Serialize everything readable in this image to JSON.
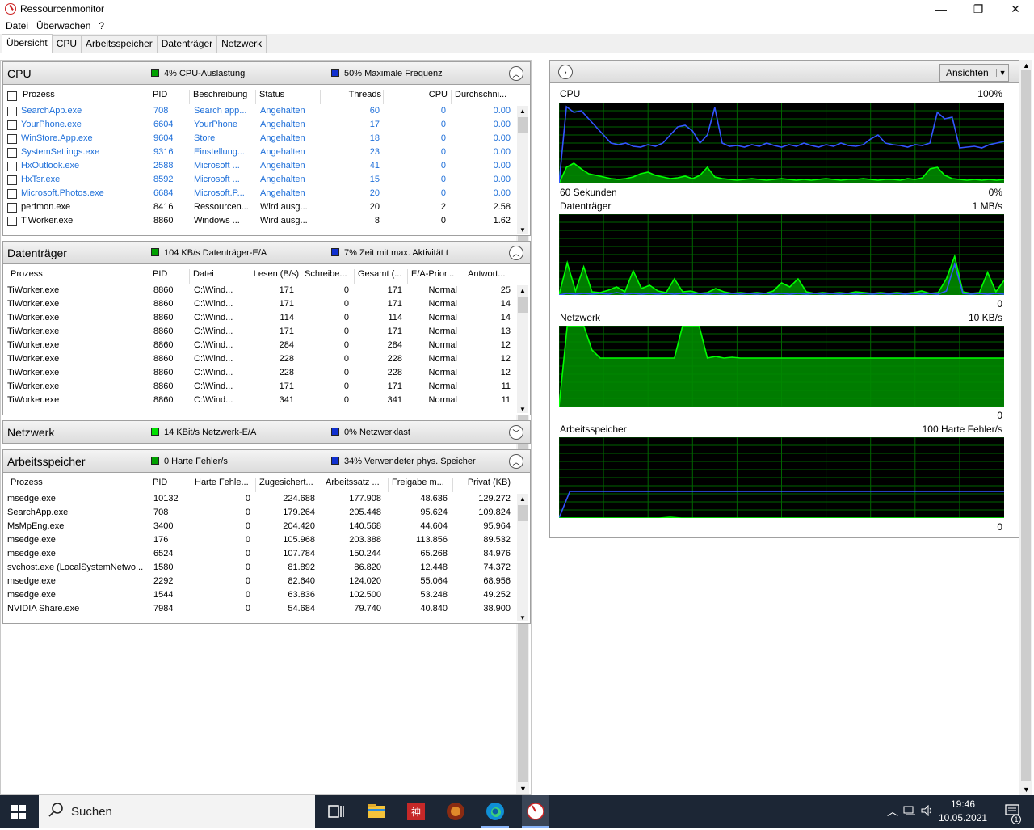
{
  "window": {
    "title": "Ressourcenmonitor",
    "minimize": "—",
    "maximize": "❐",
    "close": "✕"
  },
  "menu": [
    "Datei",
    "Überwachen",
    "?"
  ],
  "tabs": [
    "Übersicht",
    "CPU",
    "Arbeitsspeicher",
    "Datenträger",
    "Netzwerk"
  ],
  "cpu": {
    "name": "CPU",
    "stat1": "4% CPU-Auslastung",
    "stat2": "50% Maximale Frequenz",
    "columns": [
      "Prozess",
      "PID",
      "Beschreibung",
      "Status",
      "Threads",
      "CPU",
      "Durchschni..."
    ],
    "rows": [
      [
        "SearchApp.exe",
        "708",
        "Search app...",
        "Angehalten",
        "60",
        "0",
        "0.00",
        true
      ],
      [
        "YourPhone.exe",
        "6604",
        "YourPhone",
        "Angehalten",
        "17",
        "0",
        "0.00",
        true
      ],
      [
        "WinStore.App.exe",
        "9604",
        "Store",
        "Angehalten",
        "18",
        "0",
        "0.00",
        true
      ],
      [
        "SystemSettings.exe",
        "9316",
        "Einstellung...",
        "Angehalten",
        "23",
        "0",
        "0.00",
        true
      ],
      [
        "HxOutlook.exe",
        "2588",
        "Microsoft ...",
        "Angehalten",
        "41",
        "0",
        "0.00",
        true
      ],
      [
        "HxTsr.exe",
        "8592",
        "Microsoft ...",
        "Angehalten",
        "15",
        "0",
        "0.00",
        true
      ],
      [
        "Microsoft.Photos.exe",
        "6684",
        "Microsoft.P...",
        "Angehalten",
        "20",
        "0",
        "0.00",
        true
      ],
      [
        "perfmon.exe",
        "8416",
        "Ressourcen...",
        "Wird ausg...",
        "20",
        "2",
        "2.58",
        false
      ],
      [
        "TiWorker.exe",
        "8860",
        "Windows ...",
        "Wird ausg...",
        "8",
        "0",
        "1.62",
        false
      ]
    ]
  },
  "disk": {
    "name": "Datenträger",
    "stat1": "104 KB/s Datenträger-E/A",
    "stat2": "7% Zeit mit max. Aktivität t",
    "columns": [
      "Prozess",
      "PID",
      "Datei",
      "Lesen (B/s)",
      "Schreibe...",
      "Gesamt (...",
      "E/A-Prior...",
      "Antwort..."
    ],
    "rows": [
      [
        "TiWorker.exe",
        "8860",
        "C:\\Wind...",
        "171",
        "0",
        "171",
        "Normal",
        "25"
      ],
      [
        "TiWorker.exe",
        "8860",
        "C:\\Wind...",
        "171",
        "0",
        "171",
        "Normal",
        "14"
      ],
      [
        "TiWorker.exe",
        "8860",
        "C:\\Wind...",
        "114",
        "0",
        "114",
        "Normal",
        "14"
      ],
      [
        "TiWorker.exe",
        "8860",
        "C:\\Wind...",
        "171",
        "0",
        "171",
        "Normal",
        "13"
      ],
      [
        "TiWorker.exe",
        "8860",
        "C:\\Wind...",
        "284",
        "0",
        "284",
        "Normal",
        "12"
      ],
      [
        "TiWorker.exe",
        "8860",
        "C:\\Wind...",
        "228",
        "0",
        "228",
        "Normal",
        "12"
      ],
      [
        "TiWorker.exe",
        "8860",
        "C:\\Wind...",
        "228",
        "0",
        "228",
        "Normal",
        "12"
      ],
      [
        "TiWorker.exe",
        "8860",
        "C:\\Wind...",
        "171",
        "0",
        "171",
        "Normal",
        "11"
      ],
      [
        "TiWorker.exe",
        "8860",
        "C:\\Wind...",
        "341",
        "0",
        "341",
        "Normal",
        "11"
      ]
    ]
  },
  "network": {
    "name": "Netzwerk",
    "stat1": "14 KBit/s Netzwerk-E/A",
    "stat2": "0% Netzwerklast"
  },
  "memory": {
    "name": "Arbeitsspeicher",
    "stat1": "0 Harte Fehler/s",
    "stat2": "34% Verwendeter phys. Speicher",
    "columns": [
      "Prozess",
      "PID",
      "Harte Fehle...",
      "Zugesichert...",
      "Arbeitssatz ...",
      "Freigabe m...",
      "Privat (KB)"
    ],
    "rows": [
      [
        "msedge.exe",
        "10132",
        "0",
        "224.688",
        "177.908",
        "48.636",
        "129.272"
      ],
      [
        "SearchApp.exe",
        "708",
        "0",
        "179.264",
        "205.448",
        "95.624",
        "109.824"
      ],
      [
        "MsMpEng.exe",
        "3400",
        "0",
        "204.420",
        "140.568",
        "44.604",
        "95.964"
      ],
      [
        "msedge.exe",
        "176",
        "0",
        "105.968",
        "203.388",
        "113.856",
        "89.532"
      ],
      [
        "msedge.exe",
        "6524",
        "0",
        "107.784",
        "150.244",
        "65.268",
        "84.976"
      ],
      [
        "svchost.exe (LocalSystemNetwo...",
        "1580",
        "0",
        "81.892",
        "86.820",
        "12.448",
        "74.372"
      ],
      [
        "msedge.exe",
        "2292",
        "0",
        "82.640",
        "124.020",
        "55.064",
        "68.956"
      ],
      [
        "msedge.exe",
        "1544",
        "0",
        "63.836",
        "102.500",
        "53.248",
        "49.252"
      ],
      [
        "NVIDIA Share.exe",
        "7984",
        "0",
        "54.684",
        "79.740",
        "40.840",
        "38.900"
      ]
    ]
  },
  "graphs": {
    "view_button": "Ansichten",
    "cpu": {
      "title": "CPU",
      "max": "100%",
      "bottom_left": "60 Sekunden",
      "bottom_right": "0%"
    },
    "disk": {
      "title": "Datenträger",
      "max": "1 MB/s",
      "bottom_right": "0"
    },
    "net": {
      "title": "Netzwerk",
      "max": "10 KB/s",
      "bottom_right": "0"
    },
    "mem": {
      "title": "Arbeitsspeicher",
      "max": "100 Harte Fehler/s",
      "bottom_right": "0"
    }
  },
  "taskbar": {
    "search_placeholder": "Suchen",
    "time": "19:46",
    "date": "10.05.2021",
    "notif_count": "1"
  },
  "colors": {
    "graph_green": "#00ff00",
    "graph_fill": "#008a00",
    "graph_blue": "#3355ff",
    "grid": "#006400"
  }
}
